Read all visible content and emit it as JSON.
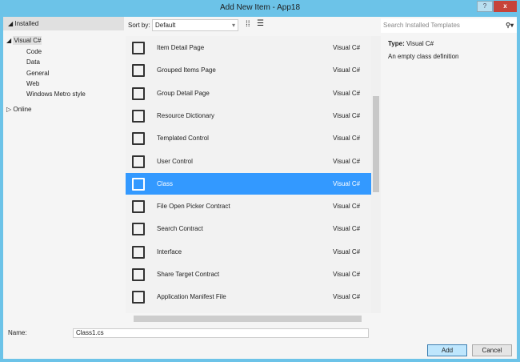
{
  "window": {
    "title": "Add New Item - App18",
    "help": "?",
    "close": "x"
  },
  "left": {
    "installed": "Installed",
    "visual_csharp": "Visual C#",
    "children": [
      "Code",
      "Data",
      "General",
      "Web",
      "Windows Metro style"
    ],
    "online": "Online"
  },
  "sort": {
    "label": "Sort by:",
    "value": "Default"
  },
  "items": [
    {
      "name": "Item Detail Page",
      "lang": "Visual C#"
    },
    {
      "name": "Grouped Items Page",
      "lang": "Visual C#"
    },
    {
      "name": "Group Detail Page",
      "lang": "Visual C#"
    },
    {
      "name": "Resource Dictionary",
      "lang": "Visual C#"
    },
    {
      "name": "Templated Control",
      "lang": "Visual C#"
    },
    {
      "name": "User Control",
      "lang": "Visual C#"
    },
    {
      "name": "Class",
      "lang": "Visual C#"
    },
    {
      "name": "File Open Picker Contract",
      "lang": "Visual C#"
    },
    {
      "name": "Search Contract",
      "lang": "Visual C#"
    },
    {
      "name": "Interface",
      "lang": "Visual C#"
    },
    {
      "name": "Share Target Contract",
      "lang": "Visual C#"
    },
    {
      "name": "Application Manifest File",
      "lang": "Visual C#"
    }
  ],
  "selected_index": 6,
  "search": {
    "placeholder": "Search Installed Templates"
  },
  "details": {
    "type_label": "Type:",
    "type_value": "Visual C#",
    "description": "An empty class definition"
  },
  "name": {
    "label": "Name:",
    "value": "Class1.cs"
  },
  "buttons": {
    "add": "Add",
    "cancel": "Cancel"
  }
}
